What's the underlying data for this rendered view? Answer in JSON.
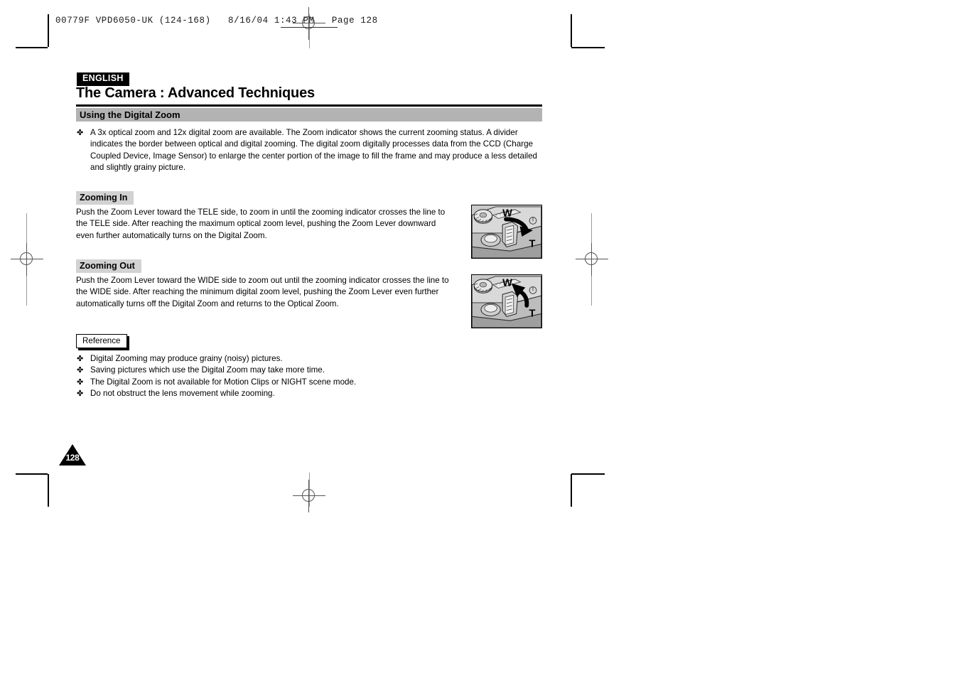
{
  "printer_slug": {
    "text": "00779F VPD6050-UK (124-168)   8/16/04 1:43 PM   Page 128"
  },
  "page": {
    "language_badge": "ENGLISH",
    "chapter_title": "The Camera : Advanced Techniques",
    "section_heading": "Using the Digital Zoom",
    "page_number": "128",
    "bullet_glyph": "✤"
  },
  "intro": {
    "bullets": [
      "A 3x optical zoom and 12x digital zoom are available. The Zoom indicator shows the current zooming status. A divider indicates the border between optical and digital zooming. The digital zoom digitally processes data from the CCD (Charge Coupled Device, Image Sensor) to enlarge the center portion of the image to fill the frame and may produce a less detailed and slightly grainy picture."
    ]
  },
  "zooming_in": {
    "heading": "Zooming In",
    "body": "Push the Zoom Lever toward the TELE side, to zoom in until the zooming indicator crosses the line to the TELE side. After reaching the maximum optical zoom level, pushing the Zoom Lever downward even further automatically turns on the Digital Zoom.",
    "figure": {
      "wide_label": "W",
      "tele_label": "T",
      "arrow_direction": "down-right"
    }
  },
  "zooming_out": {
    "heading": "Zooming Out",
    "body": "Push the Zoom Lever toward the WIDE side to zoom out until the zooming indicator crosses the line to the WIDE side. After reaching the minimum digital zoom level, pushing the Zoom Lever even further automatically turns off the Digital Zoom and returns to the Optical Zoom.",
    "figure": {
      "wide_label": "W",
      "tele_label": "T",
      "arrow_direction": "up-right"
    }
  },
  "reference": {
    "badge": "Reference",
    "bullets": [
      "Digital Zooming may produce grainy (noisy) pictures.",
      "Saving pictures which use the Digital Zoom may take more time.",
      "The Digital Zoom is not available for Motion Clips or NIGHT scene mode.",
      "Do not obstruct the lens movement while zooming."
    ]
  },
  "colors": {
    "section_bar": "#b3b3b3",
    "sub_badge": "#d2d2d2",
    "ink": "#000000",
    "paper": "#ffffff"
  }
}
